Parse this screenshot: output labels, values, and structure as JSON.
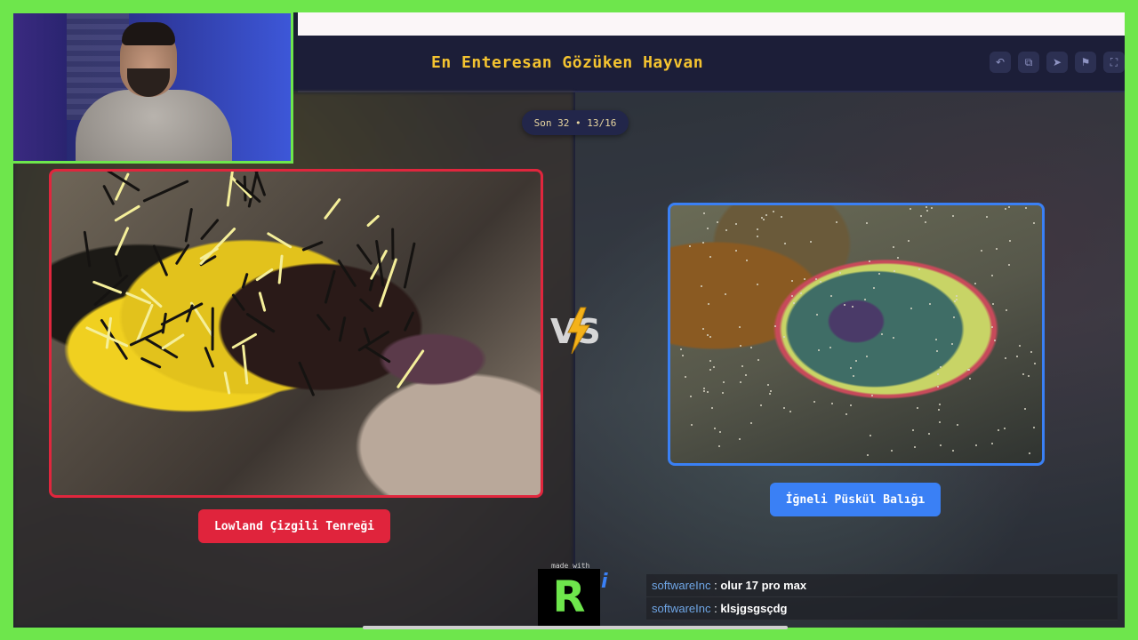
{
  "app": {
    "title": "En Enteresan Gözüken Hayvan",
    "round_info": "Son 32 • 13/16",
    "toolbar": [
      {
        "name": "undo-icon",
        "glyph": "↶"
      },
      {
        "name": "copy-icon",
        "glyph": "⧉"
      },
      {
        "name": "send-icon",
        "glyph": "➤"
      },
      {
        "name": "flag-icon",
        "glyph": "⚑"
      },
      {
        "name": "fullscreen-icon",
        "glyph": "⛶"
      }
    ]
  },
  "matchup": {
    "left": {
      "label": "Lowland Çizgili Tenreği",
      "accent": "#e0243c"
    },
    "right": {
      "label": "İğneli Püskül Balığı",
      "accent": "#3a80f5"
    },
    "vs_text": "VS"
  },
  "branding": {
    "made_with": "made with",
    "logo_letter": "R",
    "logo_tail": "i"
  },
  "chat": {
    "messages": [
      {
        "user": "softwareInc",
        "text": "olur 17 pro max"
      },
      {
        "user": "softwareInc",
        "text": "klsjgsgsçdg"
      }
    ]
  },
  "colors": {
    "frame": "#6ee64c",
    "title": "#f4c330",
    "header_bg": "#1c1e38"
  }
}
